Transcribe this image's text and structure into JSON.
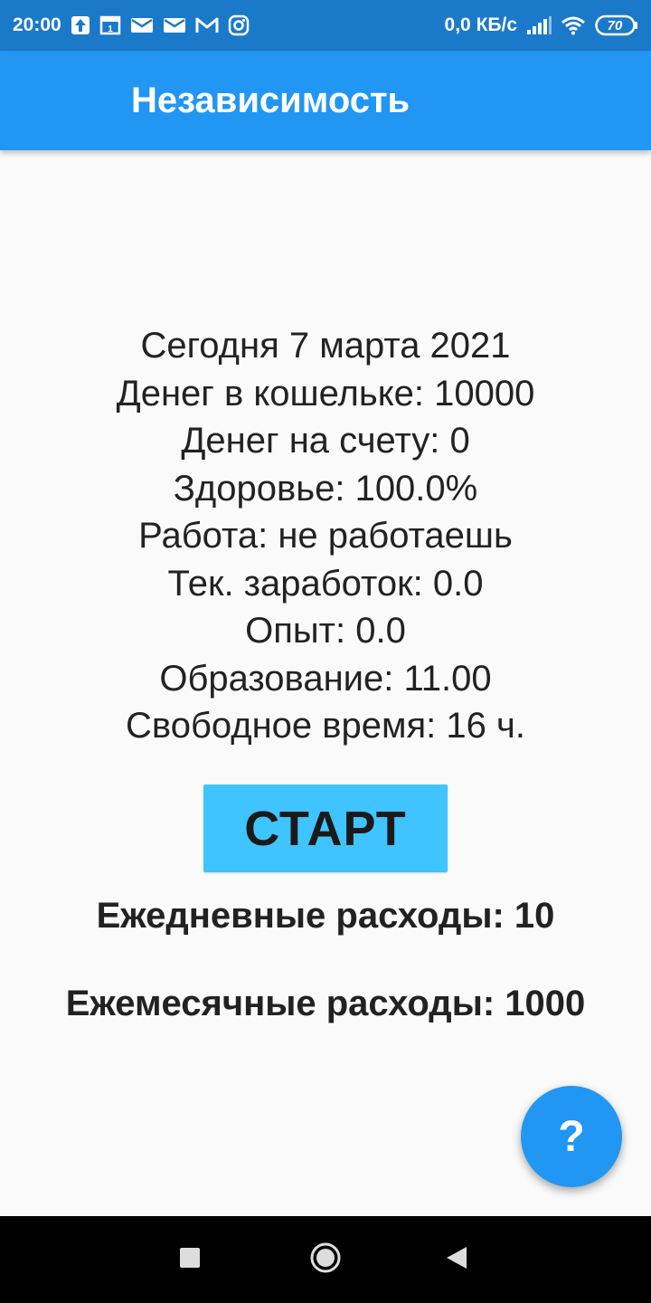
{
  "status_bar": {
    "time": "20:00",
    "network_speed": "0,0 КБ/с",
    "battery": "70",
    "icons": [
      "upload-icon",
      "calendar-icon",
      "mail-icon",
      "mail-icon",
      "gmail-icon",
      "instagram-icon",
      "signal-icon",
      "wifi-icon",
      "battery-icon"
    ]
  },
  "app_bar": {
    "title": "Независимость"
  },
  "stats": {
    "date": "Сегодня 7 марта 2021",
    "wallet": "Денег в кошельке: 10000",
    "account": "Денег на счету: 0",
    "health": "Здоровье: 100.0%",
    "job": "Работа: не работаешь",
    "earnings": "Тек. заработок: 0.0",
    "experience": "Опыт: 0.0",
    "education": "Образование: 11.00",
    "free_time": "Свободное время: 16 ч."
  },
  "start_button": {
    "label": "СТАРТ"
  },
  "expenses": {
    "daily": "Ежедневные расходы: 10",
    "monthly": "Ежемесячные расходы: 1000"
  },
  "help_button": {
    "label": "?"
  },
  "nav_bar": {
    "icons": [
      "square-icon",
      "circle-icon",
      "back-triangle-icon"
    ]
  },
  "colors": {
    "status_bar": "#1b79c9",
    "app_bar": "#2196f3",
    "start_button": "#40c4ff",
    "fab": "#2196f3",
    "background": "#fafafa"
  }
}
